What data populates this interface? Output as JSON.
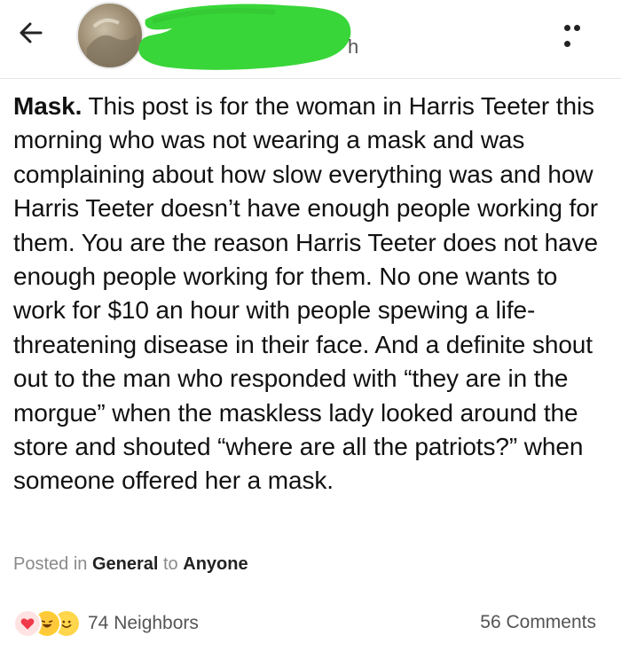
{
  "header": {
    "back_icon": "arrow-left-icon",
    "time_fragment": "h",
    "more_icon": "more-horizontal-icon",
    "redaction_color": "#39d639"
  },
  "post": {
    "subject": "Mask.",
    "body": " This post is for the woman in Harris Teeter this morning who was not wearing a mask and was complaining about how slow everything was and how Harris Teeter doesn’t have enough people working for them. You are the reason Harris Teeter does not have enough people working for them. No one wants to work for $10 an hour with people spewing a life-threatening disease in their face. And a definite shout out to the man who responded with “they are in the morgue” when the maskless lady looked around the store and shouted “where are all the patriots?” when someone offered her a mask."
  },
  "meta": {
    "posted_in_label": "Posted in",
    "category": "General",
    "to_label": "to",
    "audience": "Anyone"
  },
  "footer": {
    "reaction_icons": [
      "heart-icon",
      "laugh-emoji-icon",
      "smile-emoji-icon"
    ],
    "neighbors": "74 Neighbors",
    "comments": "56 Comments"
  }
}
